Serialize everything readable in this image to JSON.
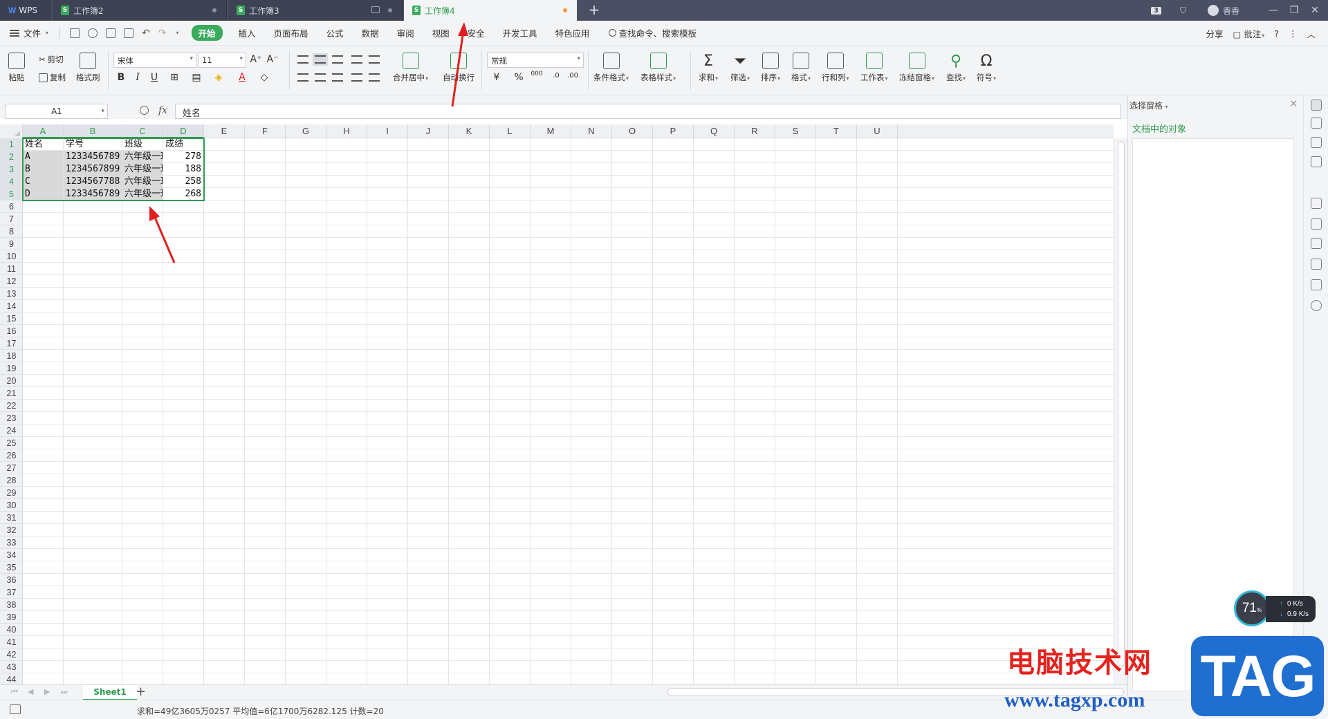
{
  "titlebar": {
    "wps_label": "WPS",
    "tabs": [
      {
        "label": "工作簿2",
        "state": "inactive"
      },
      {
        "label": "工作簿3",
        "state": "inactive"
      },
      {
        "label": "工作簿4",
        "state": "active"
      }
    ],
    "new_tab": "+",
    "badge": "3",
    "user_name": "香香",
    "window_buttons": [
      "—",
      "❐",
      "✕"
    ]
  },
  "menubar": {
    "file_label": "文件",
    "items": [
      "开始",
      "插入",
      "页面布局",
      "公式",
      "数据",
      "审阅",
      "视图",
      "安全",
      "开发工具",
      "特色应用"
    ],
    "active_item": "开始",
    "search_label": "查找命令、搜索模板",
    "right": {
      "share": "分享",
      "comment": "批注",
      "help": "?",
      "more": "⋮",
      "collapse": "︿"
    }
  },
  "ribbon": {
    "paste": "粘贴",
    "cut": "剪切",
    "copy": "复制",
    "format_painter": "格式刷",
    "font_name": "宋体",
    "font_size": "11",
    "font_grow": "A⁺",
    "font_shrink": "A⁻",
    "bold": "B",
    "italic": "I",
    "underline": "U",
    "merge_center": "合并居中",
    "wrap_text": "自动换行",
    "number_format": "常规",
    "percent": "%",
    "thousands": "000",
    "conditional_format": "条件格式",
    "table_style": "表格样式",
    "sum": "求和",
    "filter": "筛选",
    "sort": "排序",
    "format": "格式",
    "row_col": "行和列",
    "worksheet": "工作表",
    "freeze": "冻结窗格",
    "find": "查找",
    "symbol": "符号"
  },
  "formula_bar": {
    "cell_ref": "A1",
    "fx": "fx",
    "value": "姓名"
  },
  "sheet": {
    "columns": [
      "A",
      "B",
      "C",
      "D",
      "E",
      "F",
      "G",
      "H",
      "I",
      "J",
      "K",
      "L",
      "M",
      "N",
      "O",
      "P",
      "Q",
      "R",
      "S",
      "T",
      "U"
    ],
    "selected_columns": [
      "A",
      "B",
      "C",
      "D"
    ],
    "row_count": 44,
    "selected_rows": [
      1,
      2,
      3,
      4,
      5
    ],
    "table": {
      "header": [
        "姓名",
        "学号",
        "班级",
        "成绩"
      ],
      "rows": [
        [
          "A",
          "1233456789",
          "六年级一班",
          "278"
        ],
        [
          "B",
          "1234567899",
          "六年级一班",
          "188"
        ],
        [
          "C",
          "1234567788",
          "六年级一班",
          "258"
        ],
        [
          "D",
          "1233456789",
          "六年级一班",
          "268"
        ]
      ]
    }
  },
  "sheet_tabs": {
    "active": "Sheet1",
    "add": "+"
  },
  "status": {
    "text": "求和=49亿3605万0257   平均值=6亿1700万6282.125   计数=20"
  },
  "right_pane": {
    "title": "选择窗格",
    "close": "×",
    "section": "文档中的对象"
  },
  "speed_widget": {
    "percent": "71",
    "percent_unit": "%",
    "upload": "0",
    "download": "0.9",
    "unit": "K/s"
  },
  "watermark": {
    "site_name": "电脑技术网",
    "url": "www.tagxp.com",
    "logo": "TAG"
  },
  "colors": {
    "accent": "#2e9c4f",
    "titlebar": "#4a4f63",
    "annotation_arrow": "#e02020"
  }
}
